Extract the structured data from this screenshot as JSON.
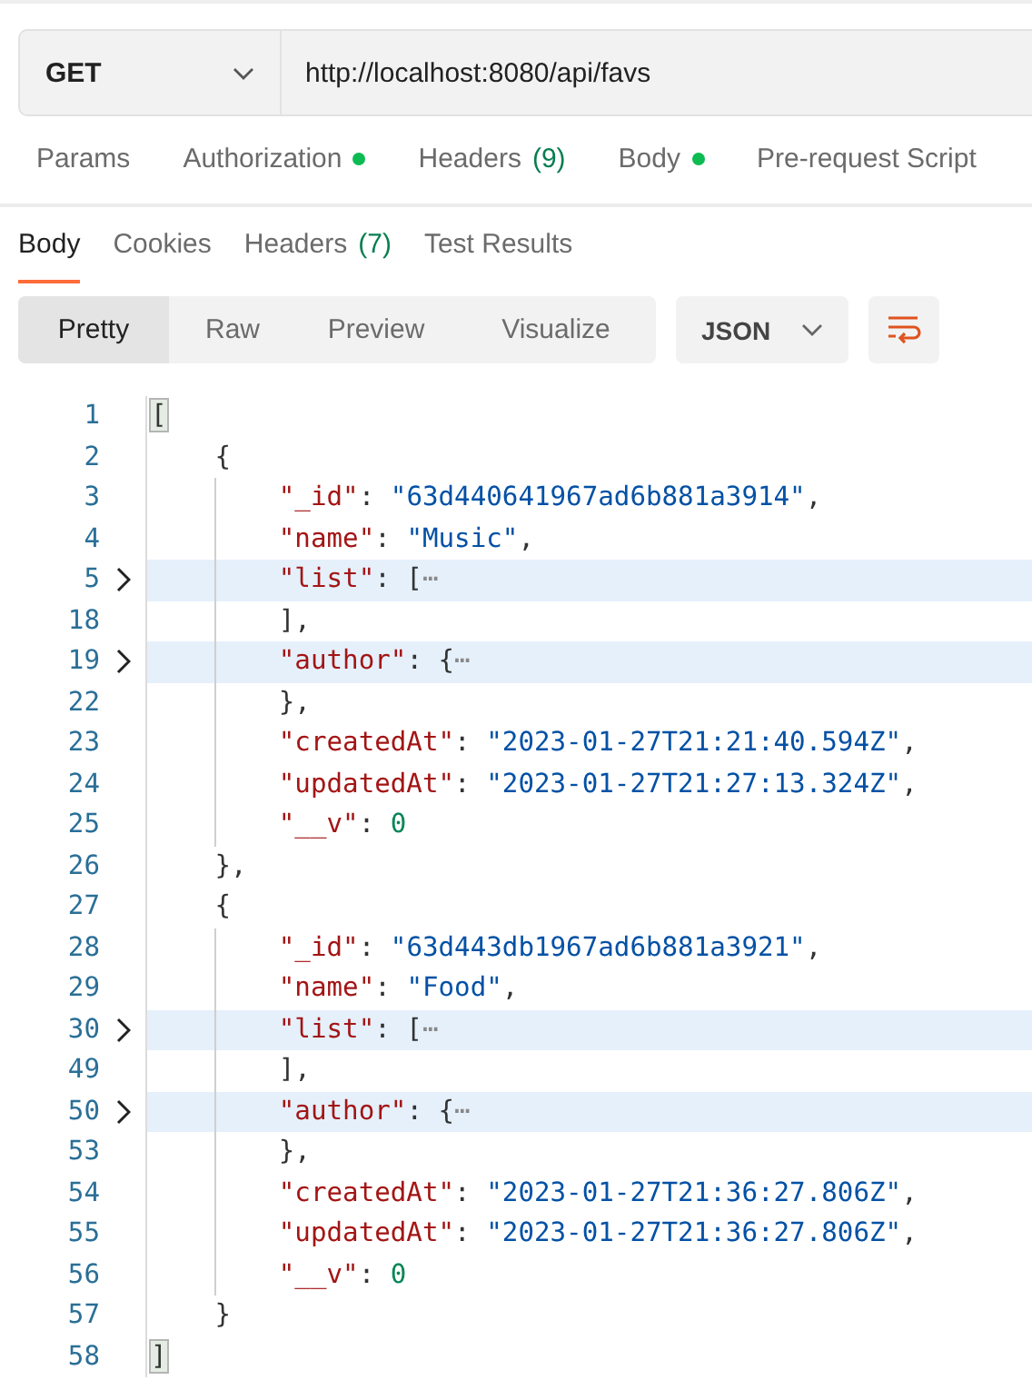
{
  "request": {
    "method": "GET",
    "url": "http://localhost:8080/api/favs"
  },
  "request_tabs": [
    {
      "label": "Params",
      "selected": false
    },
    {
      "label": "Authorization",
      "dot": true,
      "selected": false
    },
    {
      "label": "Headers",
      "count": "(9)",
      "selected": false
    },
    {
      "label": "Body",
      "dot": true,
      "selected": false
    },
    {
      "label": "Pre-request Script",
      "selected": false
    }
  ],
  "response_tabs": [
    {
      "label": "Body",
      "selected": true
    },
    {
      "label": "Cookies",
      "selected": false
    },
    {
      "label": "Headers",
      "count": "(7)",
      "selected": false
    },
    {
      "label": "Test Results",
      "selected": false
    }
  ],
  "view_modes": [
    {
      "label": "Pretty",
      "selected": true
    },
    {
      "label": "Raw",
      "selected": false
    },
    {
      "label": "Preview",
      "selected": false
    },
    {
      "label": "Visualize",
      "selected": false
    }
  ],
  "format": "JSON",
  "code": {
    "lines": [
      {
        "number": "1",
        "folded": false,
        "tokens": [
          {
            "kind": "bracket-match",
            "text": "["
          }
        ],
        "children": [
          {
            "number": "2",
            "folded": false,
            "tokens": [
              {
                "kind": "punct",
                "text": "{"
              }
            ],
            "children": [
              {
                "number": "3",
                "folded": false,
                "tokens": [
                  {
                    "kind": "key",
                    "text": "\"_id\""
                  },
                  {
                    "kind": "punct",
                    "text": ": "
                  },
                  {
                    "kind": "string",
                    "text": "\"63d440641967ad6b881a3914\""
                  },
                  {
                    "kind": "punct",
                    "text": ","
                  }
                ]
              },
              {
                "number": "4",
                "folded": false,
                "tokens": [
                  {
                    "kind": "key",
                    "text": "\"name\""
                  },
                  {
                    "kind": "punct",
                    "text": ": "
                  },
                  {
                    "kind": "string",
                    "text": "\"Music\""
                  },
                  {
                    "kind": "punct",
                    "text": ","
                  }
                ]
              },
              {
                "number": "5",
                "folded": true,
                "tokens": [
                  {
                    "kind": "key",
                    "text": "\"list\""
                  },
                  {
                    "kind": "punct",
                    "text": ": ["
                  },
                  {
                    "kind": "ellipsis",
                    "text": "⋯"
                  }
                ]
              },
              {
                "number": "18",
                "folded": false,
                "tokens": [
                  {
                    "kind": "punct",
                    "text": "],"
                  }
                ]
              },
              {
                "number": "19",
                "folded": true,
                "tokens": [
                  {
                    "kind": "key",
                    "text": "\"author\""
                  },
                  {
                    "kind": "punct",
                    "text": ": {"
                  },
                  {
                    "kind": "ellipsis",
                    "text": "⋯"
                  }
                ]
              },
              {
                "number": "22",
                "folded": false,
                "tokens": [
                  {
                    "kind": "punct",
                    "text": "},"
                  }
                ]
              },
              {
                "number": "23",
                "folded": false,
                "tokens": [
                  {
                    "kind": "key",
                    "text": "\"createdAt\""
                  },
                  {
                    "kind": "punct",
                    "text": ": "
                  },
                  {
                    "kind": "string",
                    "text": "\"2023-01-27T21:21:40.594Z\""
                  },
                  {
                    "kind": "punct",
                    "text": ","
                  }
                ]
              },
              {
                "number": "24",
                "folded": false,
                "tokens": [
                  {
                    "kind": "key",
                    "text": "\"updatedAt\""
                  },
                  {
                    "kind": "punct",
                    "text": ": "
                  },
                  {
                    "kind": "string",
                    "text": "\"2023-01-27T21:27:13.324Z\""
                  },
                  {
                    "kind": "punct",
                    "text": ","
                  }
                ]
              },
              {
                "number": "25",
                "folded": false,
                "tokens": [
                  {
                    "kind": "key",
                    "text": "\"__v\""
                  },
                  {
                    "kind": "punct",
                    "text": ": "
                  },
                  {
                    "kind": "number",
                    "text": "0"
                  }
                ]
              }
            ]
          },
          {
            "number": "26",
            "folded": false,
            "tokens": [
              {
                "kind": "punct",
                "text": "},"
              }
            ]
          },
          {
            "number": "27",
            "folded": false,
            "tokens": [
              {
                "kind": "punct",
                "text": "{"
              }
            ],
            "children": [
              {
                "number": "28",
                "folded": false,
                "tokens": [
                  {
                    "kind": "key",
                    "text": "\"_id\""
                  },
                  {
                    "kind": "punct",
                    "text": ": "
                  },
                  {
                    "kind": "string",
                    "text": "\"63d443db1967ad6b881a3921\""
                  },
                  {
                    "kind": "punct",
                    "text": ","
                  }
                ]
              },
              {
                "number": "29",
                "folded": false,
                "tokens": [
                  {
                    "kind": "key",
                    "text": "\"name\""
                  },
                  {
                    "kind": "punct",
                    "text": ": "
                  },
                  {
                    "kind": "string",
                    "text": "\"Food\""
                  },
                  {
                    "kind": "punct",
                    "text": ","
                  }
                ]
              },
              {
                "number": "30",
                "folded": true,
                "tokens": [
                  {
                    "kind": "key",
                    "text": "\"list\""
                  },
                  {
                    "kind": "punct",
                    "text": ": ["
                  },
                  {
                    "kind": "ellipsis",
                    "text": "⋯"
                  }
                ]
              },
              {
                "number": "49",
                "folded": false,
                "tokens": [
                  {
                    "kind": "punct",
                    "text": "],"
                  }
                ]
              },
              {
                "number": "50",
                "folded": true,
                "tokens": [
                  {
                    "kind": "key",
                    "text": "\"author\""
                  },
                  {
                    "kind": "punct",
                    "text": ": {"
                  },
                  {
                    "kind": "ellipsis",
                    "text": "⋯"
                  }
                ]
              },
              {
                "number": "53",
                "folded": false,
                "tokens": [
                  {
                    "kind": "punct",
                    "text": "},"
                  }
                ]
              },
              {
                "number": "54",
                "folded": false,
                "tokens": [
                  {
                    "kind": "key",
                    "text": "\"createdAt\""
                  },
                  {
                    "kind": "punct",
                    "text": ": "
                  },
                  {
                    "kind": "string",
                    "text": "\"2023-01-27T21:36:27.806Z\""
                  },
                  {
                    "kind": "punct",
                    "text": ","
                  }
                ]
              },
              {
                "number": "55",
                "folded": false,
                "tokens": [
                  {
                    "kind": "key",
                    "text": "\"updatedAt\""
                  },
                  {
                    "kind": "punct",
                    "text": ": "
                  },
                  {
                    "kind": "string",
                    "text": "\"2023-01-27T21:36:27.806Z\""
                  },
                  {
                    "kind": "punct",
                    "text": ","
                  }
                ]
              },
              {
                "number": "56",
                "folded": false,
                "tokens": [
                  {
                    "kind": "key",
                    "text": "\"__v\""
                  },
                  {
                    "kind": "punct",
                    "text": ": "
                  },
                  {
                    "kind": "number",
                    "text": "0"
                  }
                ]
              }
            ]
          },
          {
            "number": "57",
            "folded": false,
            "tokens": [
              {
                "kind": "punct",
                "text": "}"
              }
            ]
          }
        ]
      },
      {
        "number": "58",
        "folded": false,
        "tokens": [
          {
            "kind": "bracket-match",
            "text": "]"
          }
        ]
      }
    ]
  }
}
